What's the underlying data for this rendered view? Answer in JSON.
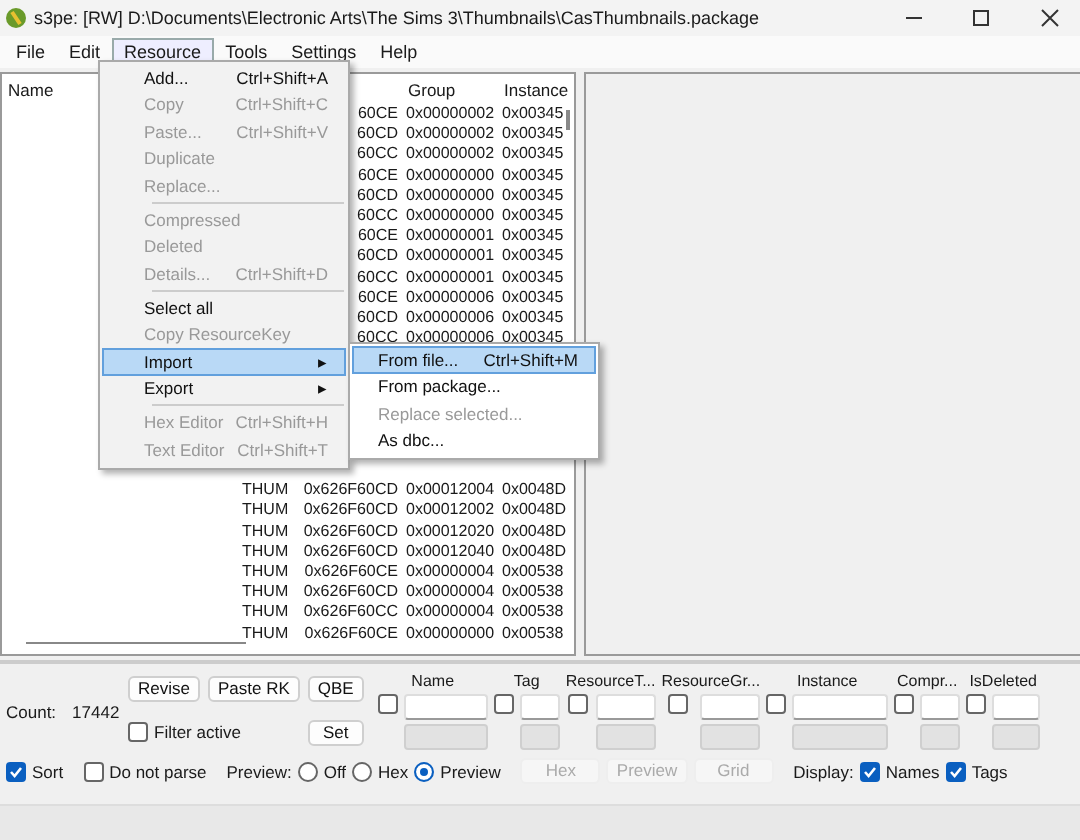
{
  "window": {
    "title": "s3pe: [RW] D:\\Documents\\Electronic Arts\\The Sims 3\\Thumbnails\\CasThumbnails.package"
  },
  "menubar": [
    {
      "label": "File",
      "selected": false
    },
    {
      "label": "Edit",
      "selected": false
    },
    {
      "label": "Resource",
      "selected": true
    },
    {
      "label": "Tools",
      "selected": false
    },
    {
      "label": "Settings",
      "selected": false
    },
    {
      "label": "Help",
      "selected": false
    }
  ],
  "resource_menu": [
    {
      "kind": "item",
      "label": "Add...",
      "shortcut": "Ctrl+Shift+A",
      "disabled": false,
      "selected": false
    },
    {
      "kind": "item",
      "label": "Copy",
      "shortcut": "Ctrl+Shift+C",
      "disabled": true,
      "selected": false
    },
    {
      "kind": "item",
      "label": "Paste...",
      "shortcut": "Ctrl+Shift+V",
      "disabled": true,
      "selected": false
    },
    {
      "kind": "item",
      "label": "Duplicate",
      "disabled": true,
      "selected": false
    },
    {
      "kind": "item",
      "label": "Replace...",
      "disabled": true,
      "selected": false
    },
    {
      "kind": "separator"
    },
    {
      "kind": "item",
      "label": "Compressed",
      "disabled": true,
      "selected": false
    },
    {
      "kind": "item",
      "label": "Deleted",
      "disabled": true,
      "selected": false
    },
    {
      "kind": "item",
      "label": "Details...",
      "shortcut": "Ctrl+Shift+D",
      "disabled": true,
      "selected": false
    },
    {
      "kind": "separator"
    },
    {
      "kind": "item",
      "label": "Select all",
      "disabled": false,
      "selected": false
    },
    {
      "kind": "item",
      "label": "Copy ResourceKey",
      "disabled": true,
      "selected": false
    },
    {
      "kind": "submenu",
      "label": "Import",
      "arrow": "▸",
      "disabled": false,
      "selected": true
    },
    {
      "kind": "submenu",
      "label": "Export",
      "arrow": "▸",
      "disabled": false,
      "selected": false
    },
    {
      "kind": "separator"
    },
    {
      "kind": "item",
      "label": "Hex Editor",
      "shortcut": "Ctrl+Shift+H",
      "disabled": true,
      "selected": false
    },
    {
      "kind": "item",
      "label": "Text Editor",
      "shortcut": "Ctrl+Shift+T",
      "disabled": true,
      "selected": false
    }
  ],
  "import_submenu": [
    {
      "label": "From file...",
      "shortcut": "Ctrl+Shift+M",
      "disabled": false,
      "selected": true
    },
    {
      "label": "From package...",
      "disabled": false,
      "selected": false
    },
    {
      "label": "Replace selected...",
      "disabled": true,
      "selected": false
    },
    {
      "label": "As dbc...",
      "disabled": false,
      "selected": false
    }
  ],
  "table": {
    "columns": [
      "Name",
      "Group",
      "Instance"
    ],
    "rows_top": [
      {
        "type": "60CE",
        "group": "0x00000002",
        "instance": "0x00345"
      },
      {
        "type": "60CD",
        "group": "0x00000002",
        "instance": "0x00345"
      },
      {
        "type": "60CC",
        "group": "0x00000002",
        "instance": "0x00345"
      },
      {
        "type": "60CE",
        "group": "0x00000000",
        "instance": "0x00345"
      },
      {
        "type": "60CD",
        "group": "0x00000000",
        "instance": "0x00345"
      },
      {
        "type": "60CC",
        "group": "0x00000000",
        "instance": "0x00345"
      },
      {
        "type": "60CE",
        "group": "0x00000001",
        "instance": "0x00345"
      },
      {
        "type": "60CD",
        "group": "0x00000001",
        "instance": "0x00345"
      },
      {
        "type": "60CC",
        "group": "0x00000001",
        "instance": "0x00345"
      },
      {
        "type": "60CE",
        "group": "0x00000006",
        "instance": "0x00345"
      },
      {
        "type": "60CD",
        "group": "0x00000006",
        "instance": "0x00345"
      },
      {
        "type": "60CC",
        "group": "0x00000006",
        "instance": "0x00345"
      }
    ],
    "rows_bottom": [
      {
        "tag": "THUM",
        "type": "0x626F60CD",
        "group": "0x00012004",
        "instance": "0x0048D"
      },
      {
        "tag": "THUM",
        "type": "0x626F60CD",
        "group": "0x00012002",
        "instance": "0x0048D"
      },
      {
        "tag": "THUM",
        "type": "0x626F60CD",
        "group": "0x00012020",
        "instance": "0x0048D"
      },
      {
        "tag": "THUM",
        "type": "0x626F60CD",
        "group": "0x00012040",
        "instance": "0x0048D"
      },
      {
        "tag": "THUM",
        "type": "0x626F60CE",
        "group": "0x00000004",
        "instance": "0x00538"
      },
      {
        "tag": "THUM",
        "type": "0x626F60CD",
        "group": "0x00000004",
        "instance": "0x00538"
      },
      {
        "tag": "THUM",
        "type": "0x626F60CC",
        "group": "0x00000004",
        "instance": "0x00538"
      },
      {
        "tag": "THUM",
        "type": "0x626F60CE",
        "group": "0x00000000",
        "instance": "0x00538"
      }
    ]
  },
  "count": {
    "label": "Count:",
    "value": "17442"
  },
  "buttons": {
    "revise": "Revise",
    "paste_rk": "Paste RK",
    "qbe": "QBE",
    "set": "Set"
  },
  "filter_active": {
    "label": "Filter active",
    "checked": false
  },
  "filters": [
    {
      "label": "Name",
      "checked": false
    },
    {
      "label": "Tag",
      "checked": false
    },
    {
      "label": "ResourceT...",
      "checked": false
    },
    {
      "label": "ResourceGr...",
      "checked": false
    },
    {
      "label": "Instance",
      "checked": false
    },
    {
      "label": "Compr...",
      "checked": false
    },
    {
      "label": "IsDeleted",
      "checked": false
    }
  ],
  "sort": {
    "label": "Sort",
    "checked": true
  },
  "do_not_parse": {
    "label": "Do not parse",
    "checked": false
  },
  "preview": {
    "label": "Preview:",
    "options": [
      {
        "label": "Off",
        "selected": false
      },
      {
        "label": "Hex",
        "selected": false
      },
      {
        "label": "Preview",
        "selected": true
      }
    ]
  },
  "view_buttons": [
    {
      "label": "Hex",
      "disabled": true
    },
    {
      "label": "Preview",
      "disabled": true
    },
    {
      "label": "Grid",
      "disabled": true
    }
  ],
  "display": {
    "label": "Display:",
    "options": [
      {
        "label": "Names",
        "checked": true
      },
      {
        "label": "Tags",
        "checked": true
      }
    ]
  }
}
